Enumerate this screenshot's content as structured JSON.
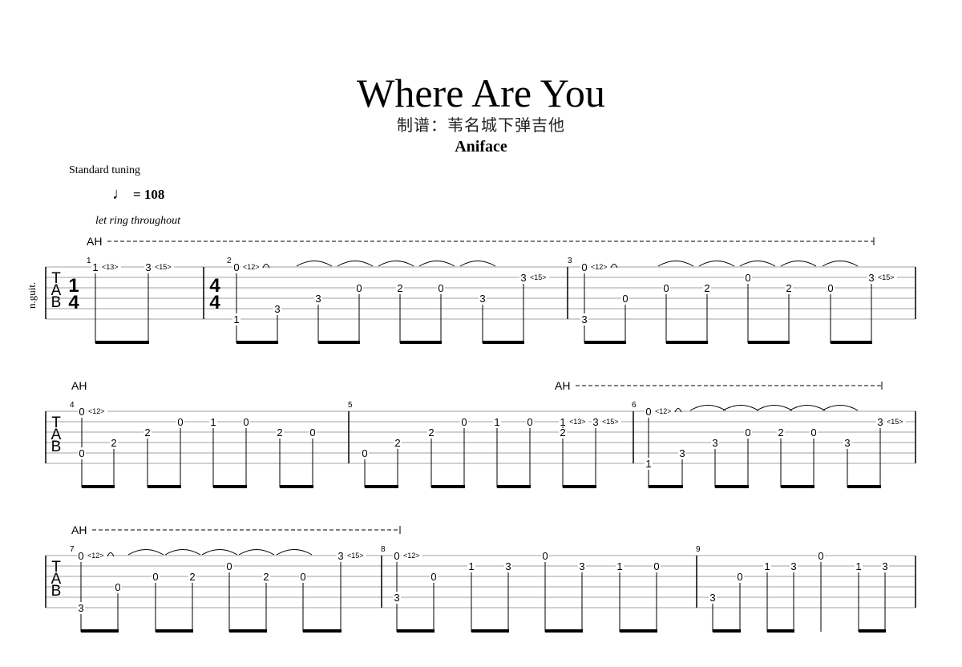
{
  "header": {
    "title": "Where Are You",
    "subtitle": "制谱：苇名城下弹吉他",
    "artist": "Aniface"
  },
  "score_info": {
    "tuning": "Standard tuning",
    "tempo_glyph": "♩",
    "tempo_text": "= 108",
    "performance_note": "let ring throughout",
    "instrument": "n.guit.",
    "clef": [
      "T",
      "A",
      "B"
    ],
    "harmonic_label": "AH"
  },
  "systems": [
    {
      "harmonic_marks": [
        {
          "label": "AH",
          "dashed": true
        }
      ],
      "measures": [
        {
          "number": "1",
          "time_signature": [
            "1",
            "4"
          ],
          "notes": [
            {
              "string": 1,
              "fret": "1",
              "harmonic": "<13>"
            },
            {
              "string": 1,
              "fret": "3",
              "harmonic": "<15>"
            }
          ]
        },
        {
          "number": "2",
          "time_signature": [
            "4",
            "4"
          ],
          "notes": [
            {
              "string": 1,
              "fret": "0",
              "harmonic": "<12>",
              "tie": true
            },
            {
              "string": 6,
              "fret": "1"
            },
            {
              "string": 5,
              "fret": "3"
            },
            {
              "string": 4,
              "fret": "3"
            },
            {
              "string": 3,
              "fret": "0"
            },
            {
              "string": 3,
              "fret": "2"
            },
            {
              "string": 3,
              "fret": "0"
            },
            {
              "string": 4,
              "fret": "3"
            },
            {
              "string": 2,
              "fret": "3",
              "harmonic": "<15>"
            }
          ]
        },
        {
          "number": "3",
          "notes": [
            {
              "string": 1,
              "fret": "0",
              "harmonic": "<12>",
              "tie": true
            },
            {
              "string": 6,
              "fret": "3"
            },
            {
              "string": 4,
              "fret": "0"
            },
            {
              "string": 3,
              "fret": "0"
            },
            {
              "string": 3,
              "fret": "2"
            },
            {
              "string": 2,
              "fret": "0"
            },
            {
              "string": 3,
              "fret": "2"
            },
            {
              "string": 3,
              "fret": "0"
            },
            {
              "string": 2,
              "fret": "3",
              "harmonic": "<15>"
            }
          ]
        }
      ]
    },
    {
      "harmonic_marks": [
        {
          "label": "AH",
          "dashed": false
        },
        {
          "label": "AH",
          "dashed": true
        }
      ],
      "measures": [
        {
          "number": "4",
          "notes": [
            {
              "string": 1,
              "fret": "0",
              "harmonic": "<12>"
            },
            {
              "string": 5,
              "fret": "0"
            },
            {
              "string": 4,
              "fret": "2"
            },
            {
              "string": 3,
              "fret": "2"
            },
            {
              "string": 2,
              "fret": "0"
            },
            {
              "string": 2,
              "fret": "1"
            },
            {
              "string": 2,
              "fret": "0"
            },
            {
              "string": 3,
              "fret": "2"
            },
            {
              "string": 3,
              "fret": "0"
            }
          ]
        },
        {
          "number": "5",
          "notes": [
            {
              "string": 5,
              "fret": "0"
            },
            {
              "string": 4,
              "fret": "2"
            },
            {
              "string": 3,
              "fret": "2"
            },
            {
              "string": 2,
              "fret": "0"
            },
            {
              "string": 2,
              "fret": "1"
            },
            {
              "string": 2,
              "fret": "0"
            },
            {
              "string": 2,
              "fret": "1",
              "harmonic": "<13>"
            },
            {
              "string": 3,
              "fret": "2"
            },
            {
              "string": 2,
              "fret": "3",
              "harmonic": "<15>"
            }
          ]
        },
        {
          "number": "6",
          "notes": [
            {
              "string": 1,
              "fret": "0",
              "harmonic": "<12>",
              "tie": true
            },
            {
              "string": 6,
              "fret": "1"
            },
            {
              "string": 5,
              "fret": "3"
            },
            {
              "string": 4,
              "fret": "3"
            },
            {
              "string": 3,
              "fret": "0"
            },
            {
              "string": 3,
              "fret": "2"
            },
            {
              "string": 3,
              "fret": "0"
            },
            {
              "string": 4,
              "fret": "3"
            },
            {
              "string": 2,
              "fret": "3",
              "harmonic": "<15>"
            }
          ]
        }
      ]
    },
    {
      "harmonic_marks": [
        {
          "label": "AH",
          "dashed": true
        }
      ],
      "measures": [
        {
          "number": "7",
          "notes": [
            {
              "string": 1,
              "fret": "0",
              "harmonic": "<12>",
              "tie": true
            },
            {
              "string": 6,
              "fret": "3"
            },
            {
              "string": 4,
              "fret": "0"
            },
            {
              "string": 3,
              "fret": "0"
            },
            {
              "string": 3,
              "fret": "2"
            },
            {
              "string": 2,
              "fret": "0"
            },
            {
              "string": 3,
              "fret": "2"
            },
            {
              "string": 3,
              "fret": "0"
            },
            {
              "string": 1,
              "fret": "3",
              "harmonic": "<15>"
            }
          ]
        },
        {
          "number": "8",
          "notes": [
            {
              "string": 1,
              "fret": "0",
              "harmonic": "<12>"
            },
            {
              "string": 5,
              "fret": "3"
            },
            {
              "string": 3,
              "fret": "0"
            },
            {
              "string": 2,
              "fret": "1"
            },
            {
              "string": 2,
              "fret": "3"
            },
            {
              "string": 1,
              "fret": "0"
            },
            {
              "string": 2,
              "fret": "3"
            },
            {
              "string": 2,
              "fret": "1"
            },
            {
              "string": 2,
              "fret": "0"
            }
          ]
        },
        {
          "number": "9",
          "notes": [
            {
              "string": 5,
              "fret": "3"
            },
            {
              "string": 3,
              "fret": "0"
            },
            {
              "string": 2,
              "fret": "1"
            },
            {
              "string": 2,
              "fret": "3"
            },
            {
              "string": 1,
              "fret": "0"
            },
            {
              "string": 2,
              "fret": "1"
            },
            {
              "string": 2,
              "fret": "3"
            }
          ]
        }
      ]
    }
  ]
}
